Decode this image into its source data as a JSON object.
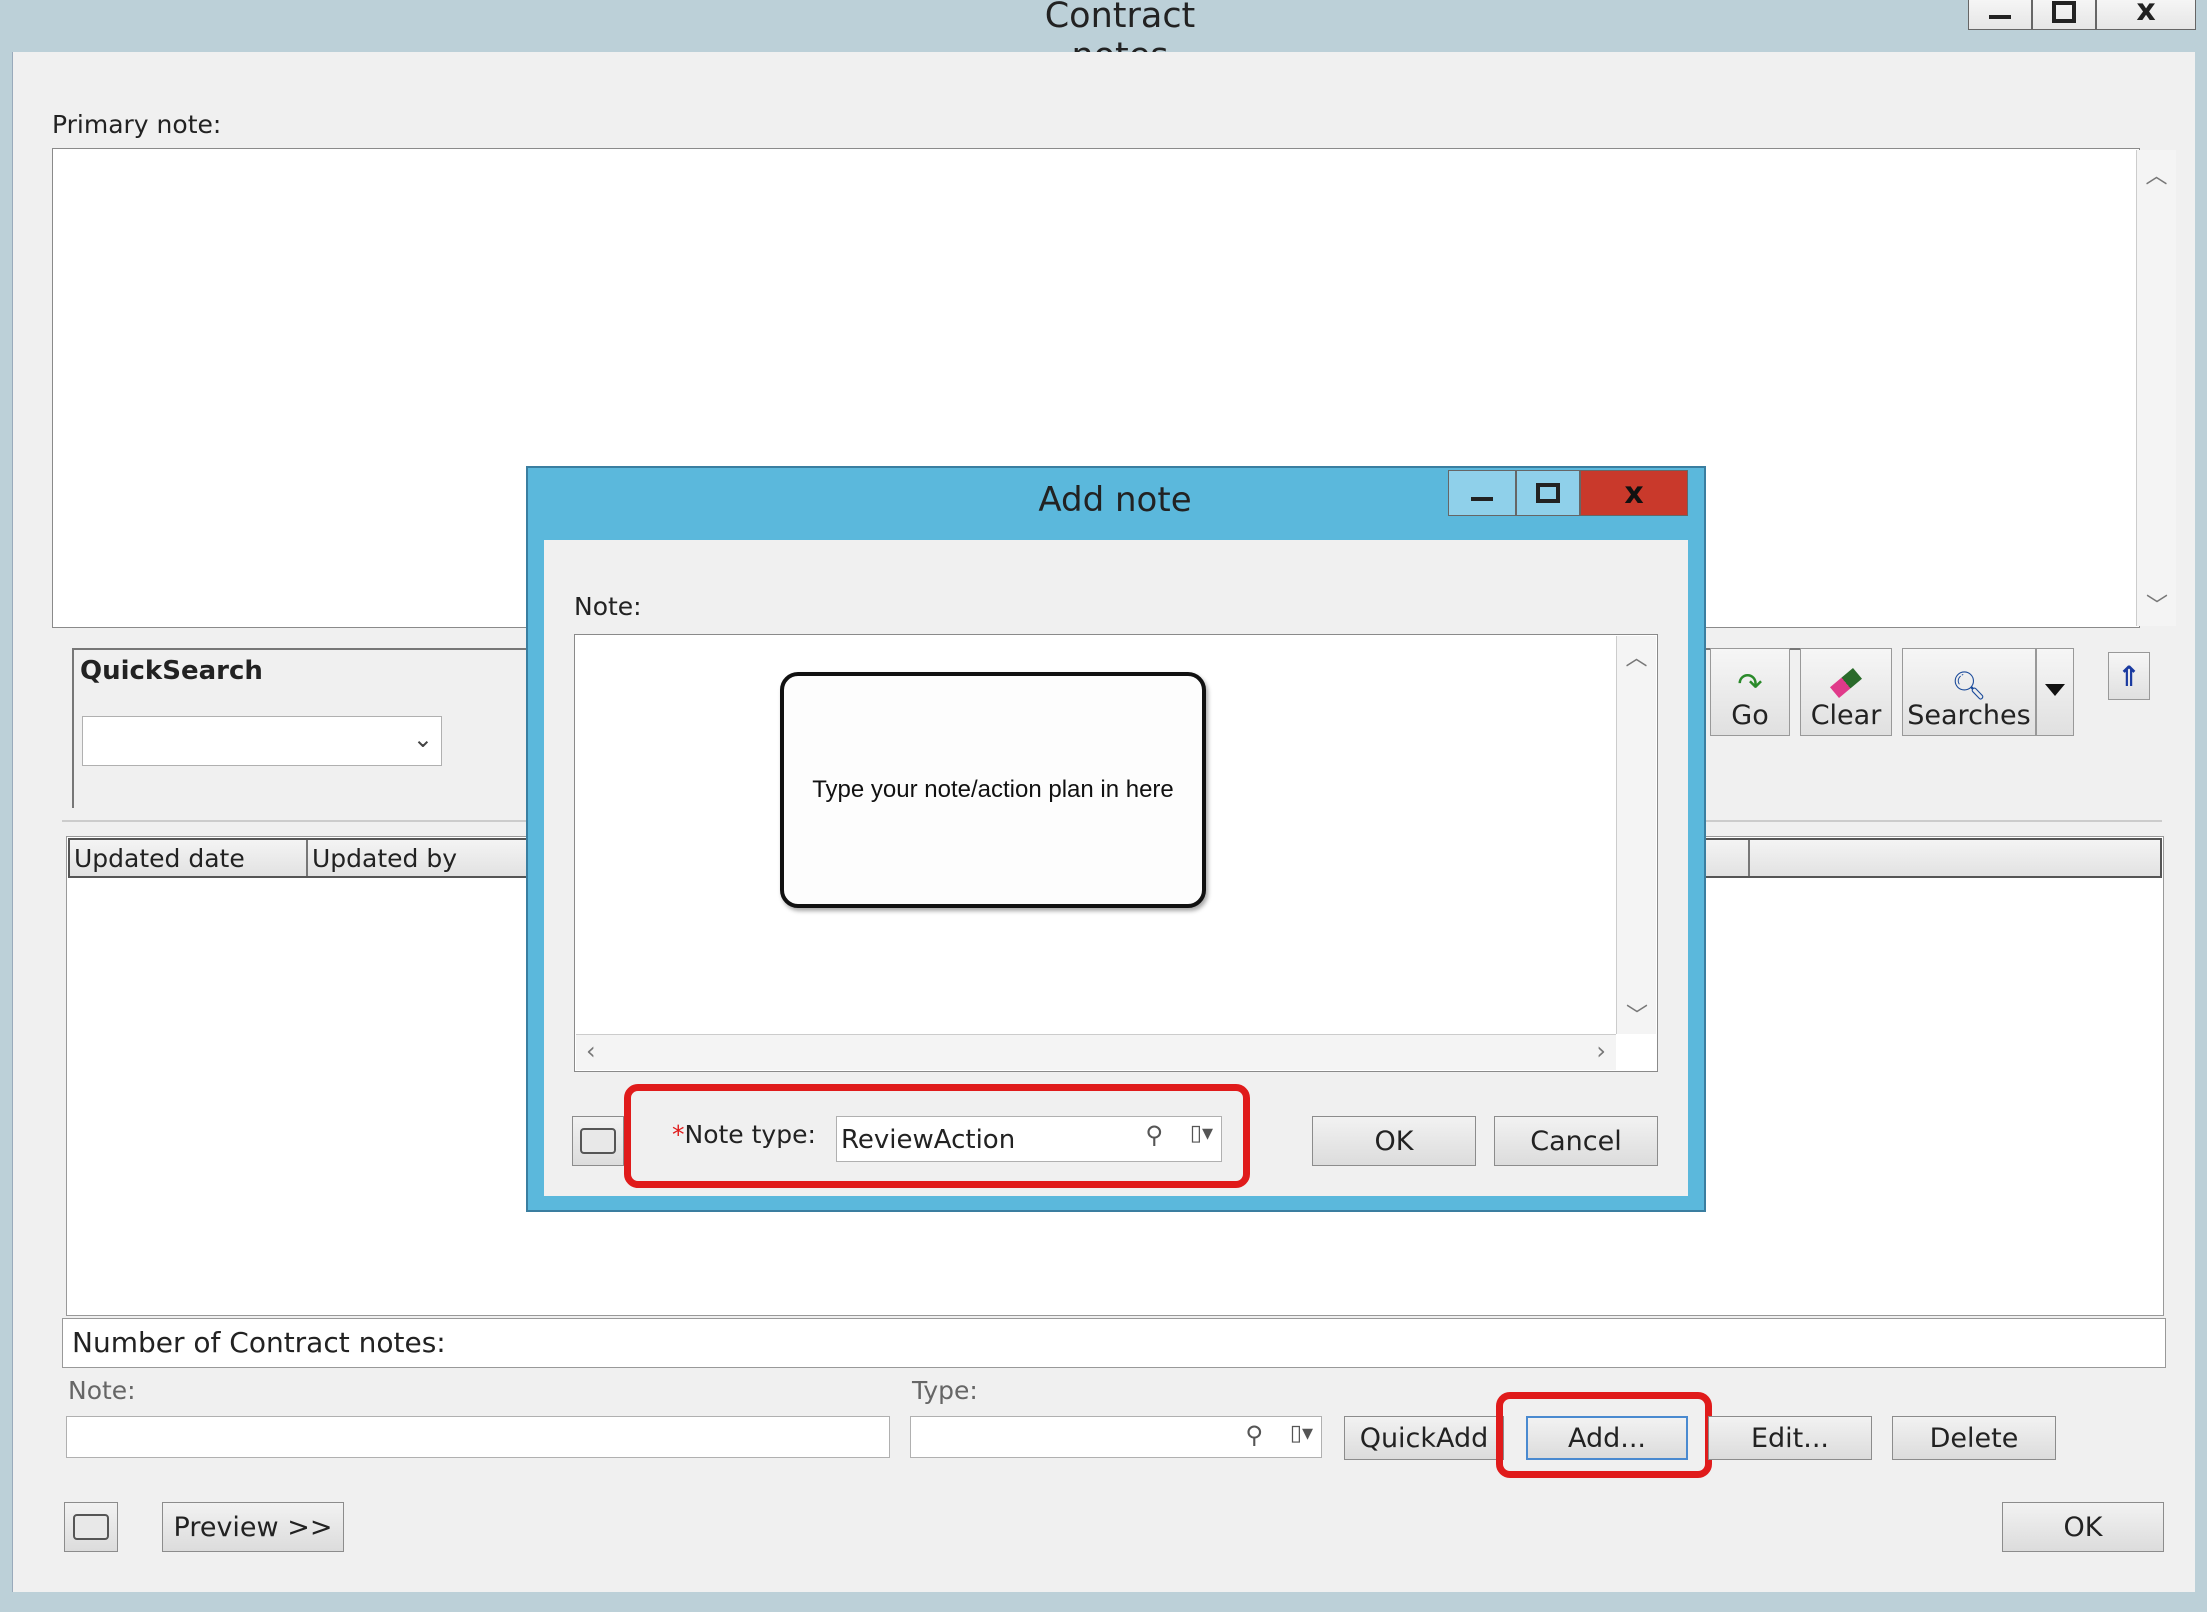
{
  "main_window": {
    "title": "Contract notes",
    "primary_note_label": "Primary note:",
    "quicksearch_label": "QuickSearch",
    "toolbar": {
      "go": "Go",
      "clear": "Clear",
      "searches": "Searches"
    },
    "columns": [
      "Updated date",
      "Updated by"
    ],
    "count_label": "Number of Contract notes:",
    "note_label": "Note:",
    "type_label": "Type:",
    "buttons": {
      "quickadd": "QuickAdd",
      "add": "Add...",
      "edit": "Edit...",
      "delete": "Delete",
      "preview": "Preview >>",
      "ok": "OK"
    },
    "window_controls": {
      "close": "x"
    }
  },
  "dialog": {
    "title": "Add note",
    "note_label": "Note:",
    "callout_text": "Type your note/action plan in here",
    "required_marker": "*",
    "note_type_label": "Note type:",
    "note_type_value": "ReviewAction",
    "ok": "OK",
    "cancel": "Cancel",
    "close": "x"
  },
  "colors": {
    "highlight": "#e01b1b",
    "dialog_frame": "#5bb8dc",
    "dialog_close": "#c9392b"
  }
}
